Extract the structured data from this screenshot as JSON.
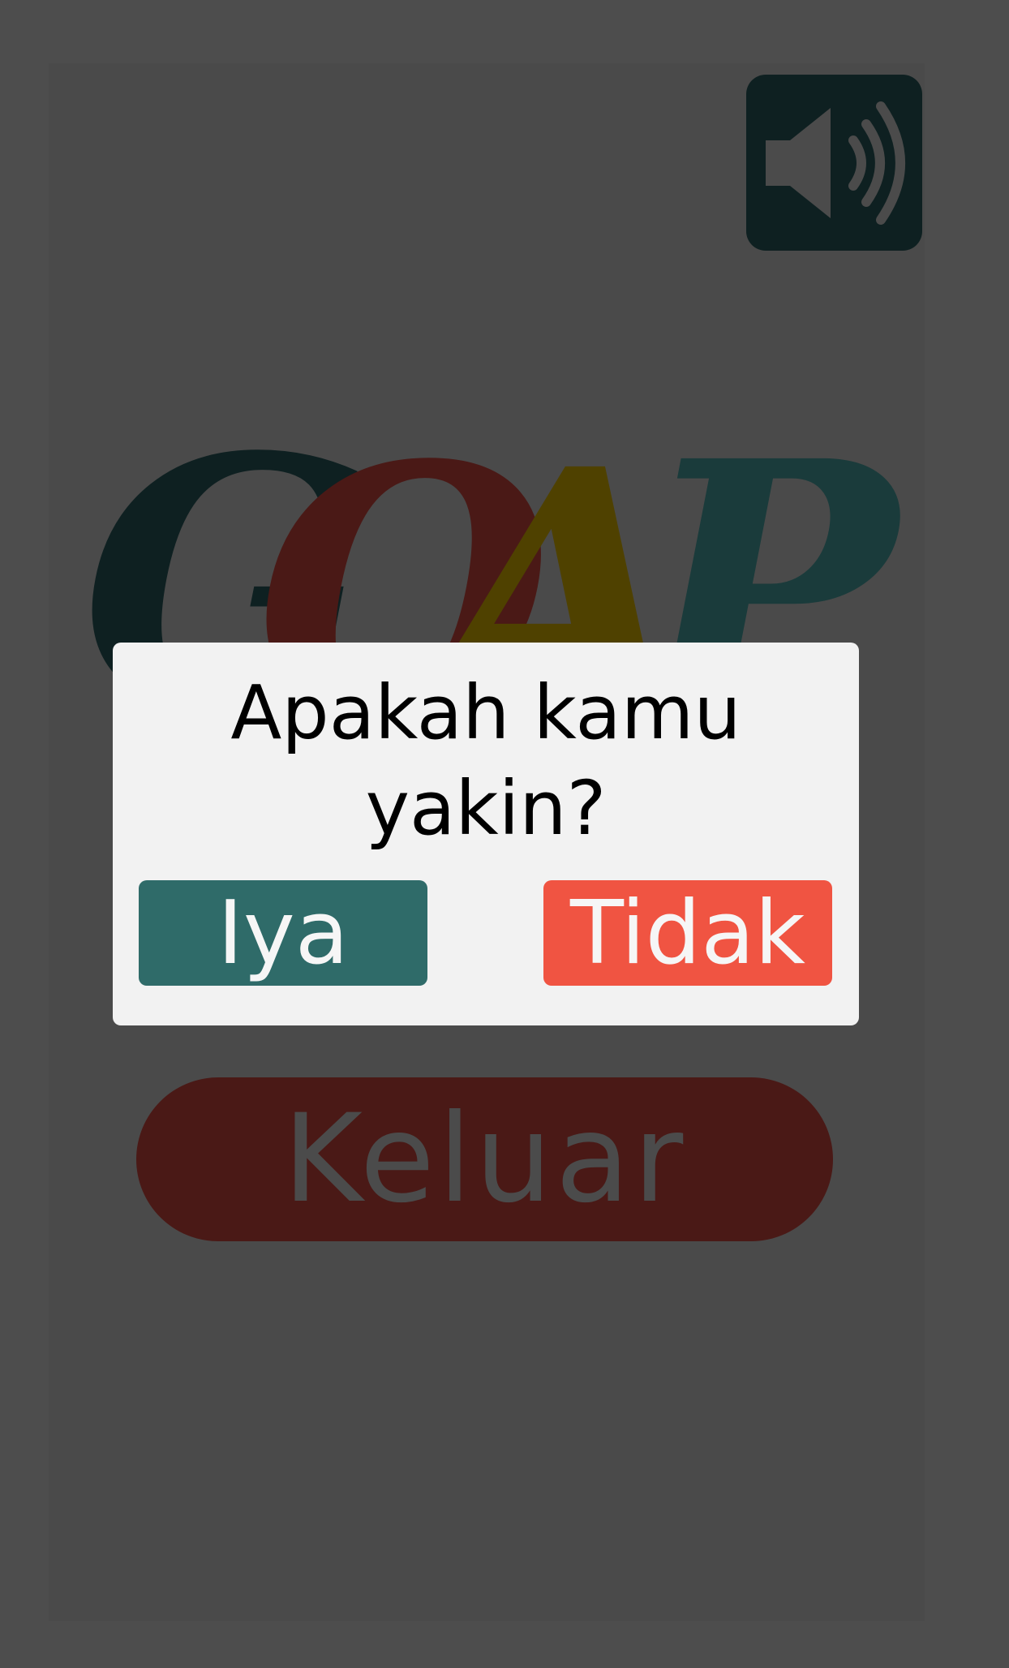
{
  "colors": {
    "overlay": "#4d4d4d",
    "sound_button": "#0e2021",
    "logo_letter_1": "#0e2021",
    "logo_letter_2": "#4a1916",
    "logo_letter_3": "#4f4100",
    "logo_letter_4": "#1a3b3b",
    "keluar_button": "#4a1916",
    "dialog_background": "#f2f2f2",
    "yes_button": "#2f6b69",
    "no_button": "#f05442"
  },
  "sound_button": {
    "icon": "speaker-volume-icon"
  },
  "logo": {
    "letters": [
      "G",
      "O",
      "A",
      "P"
    ]
  },
  "menu": {
    "exit_label": "Keluar"
  },
  "dialog": {
    "question": "Apakah kamu yakin?",
    "yes_label": "Iya",
    "no_label": "Tidak"
  }
}
